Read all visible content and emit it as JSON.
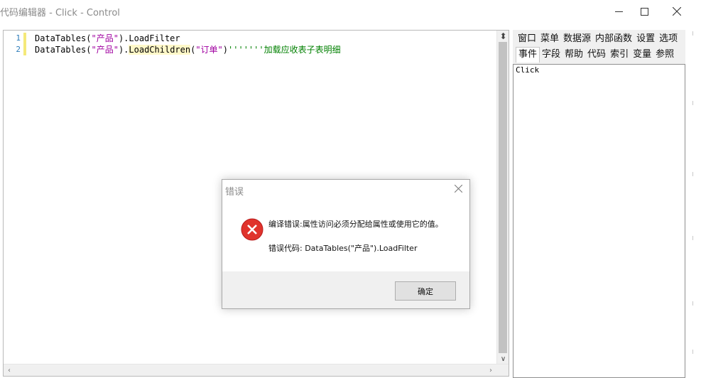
{
  "window": {
    "title": "代码编辑器 - Click - Control",
    "minimize_icon": "minimize-icon",
    "maximize_icon": "maximize-icon",
    "close_icon": "close-icon"
  },
  "editor": {
    "line_numbers": [
      "1",
      "2"
    ],
    "lines": [
      {
        "parts": [
          {
            "text": "DataTables(",
            "style": "plain"
          },
          {
            "text": "\"产品\"",
            "style": "mag"
          },
          {
            "text": ").LoadFilter",
            "style": "plain"
          }
        ]
      },
      {
        "parts": [
          {
            "text": "DataTables(",
            "style": "plain"
          },
          {
            "text": "\"产品\"",
            "style": "mag"
          },
          {
            "text": ").",
            "style": "plain"
          },
          {
            "text": "LoadChildren",
            "style": "hl"
          },
          {
            "text": "(",
            "style": "plain"
          },
          {
            "text": "\"订单\"",
            "style": "mag"
          },
          {
            "text": ")",
            "style": "plain"
          },
          {
            "text": "'''''''加载应收表子表明细",
            "style": "com"
          }
        ]
      }
    ],
    "split_icon": "split-icon",
    "scroll_down_icon": "chevron-down-icon",
    "scroll_left_icon": "chevron-left-icon",
    "scroll_right_icon": "chevron-right-icon"
  },
  "panel": {
    "tabs_row1": [
      "窗口",
      "菜单",
      "数据源",
      "内部函数",
      "设置",
      "选项"
    ],
    "tabs_row2": [
      "事件",
      "字段",
      "帮助",
      "代码",
      "索引",
      "变量",
      "参照"
    ],
    "active_tab": "事件",
    "list_items": [
      "Click"
    ]
  },
  "dialog": {
    "title": "错误",
    "message": "编译错误:属性访问必须分配给属性或使用它的值。",
    "code_label": "错误代码: DataTables(\"产品\").LoadFilter",
    "ok_label": "确定",
    "error_icon": "error-icon",
    "icon_color": "#e0332c"
  }
}
